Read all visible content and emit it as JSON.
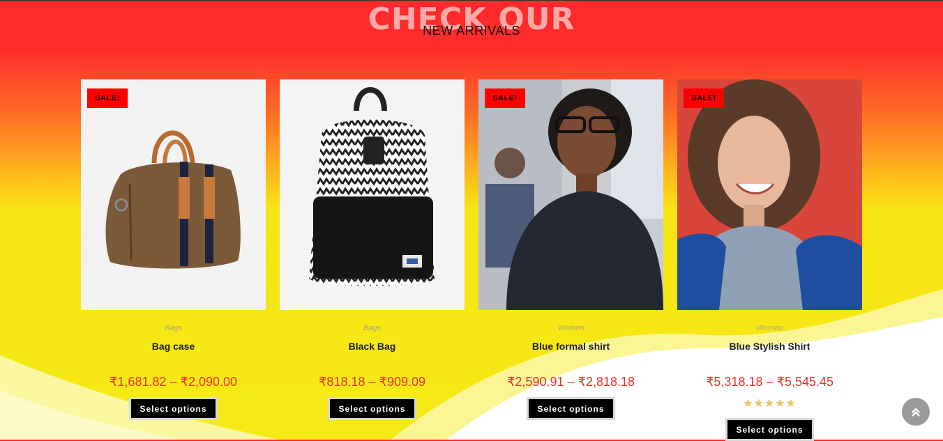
{
  "section": {
    "title_big": "CHECK OUR",
    "title_small": "NEW ARRIVALS"
  },
  "products": [
    {
      "name": "Bag case",
      "category": "Bags",
      "price": "₹1,681.82 – ₹2,090.00",
      "sale_badge": "SALE!",
      "button": "Select options",
      "image": "brown-duffel-bag"
    },
    {
      "name": "Black Bag",
      "category": "Bags",
      "price": "₹818.18 – ₹909.09",
      "button": "Select options",
      "image": "patterned-backpack"
    },
    {
      "name": "Blue formal shirt",
      "category": "Women",
      "price": "₹2,590.91 – ₹2,818.18",
      "sale_badge": "SALE!",
      "button": "Select options",
      "image": "woman-glasses-shirt"
    },
    {
      "name": "Blue Stylish Shirt",
      "category": "Women",
      "price": "₹5,318.18 – ₹5,545.45",
      "sale_badge": "SALE!",
      "rating": "★★★★★",
      "rating_value": 5,
      "button": "Select options",
      "image": "woman-denim-jacket"
    }
  ],
  "scroll_top_icon": "double-chevron-up-icon",
  "colors": {
    "accent_red": "#ff0000",
    "price": "#e9302a",
    "button": "#000000",
    "stars": "#e8c260"
  }
}
